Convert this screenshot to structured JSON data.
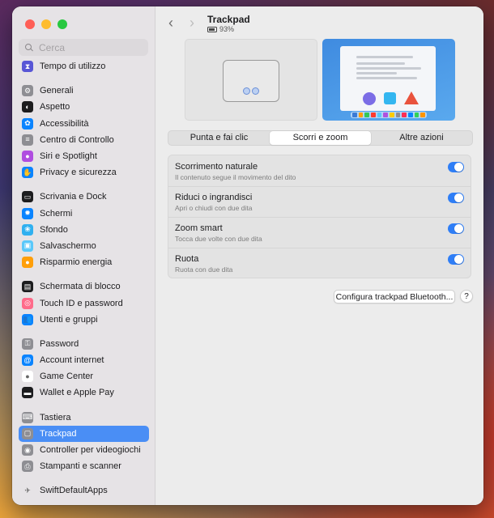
{
  "window": {
    "title": "Trackpad",
    "battery": "93%"
  },
  "search": {
    "placeholder": "Cerca"
  },
  "sidebar": {
    "items": [
      {
        "label": "Tempo di utilizzo",
        "icon": "hourglass-icon",
        "color": "#5856d6",
        "glyph": "⧗"
      },
      {
        "gap": true
      },
      {
        "label": "Generali",
        "icon": "gear-icon",
        "color": "#8e8e93",
        "glyph": "⚙"
      },
      {
        "label": "Aspetto",
        "icon": "appearance-icon",
        "color": "#1c1c1e",
        "glyph": "◐"
      },
      {
        "label": "Accessibilità",
        "icon": "accessibility-icon",
        "color": "#0a84ff",
        "glyph": "✿"
      },
      {
        "label": "Centro di Controllo",
        "icon": "control-center-icon",
        "color": "#8e8e93",
        "glyph": "≡"
      },
      {
        "label": "Siri e Spotlight",
        "icon": "siri-icon",
        "color": "#b04de0",
        "glyph": "●"
      },
      {
        "label": "Privacy e sicurezza",
        "icon": "hand-icon",
        "color": "#0a84ff",
        "glyph": "✋"
      },
      {
        "gap": true
      },
      {
        "label": "Scrivania e Dock",
        "icon": "dock-icon",
        "color": "#1c1c1e",
        "glyph": "▭"
      },
      {
        "label": "Schermi",
        "icon": "display-icon",
        "color": "#0a84ff",
        "glyph": "✹"
      },
      {
        "label": "Sfondo",
        "icon": "wallpaper-icon",
        "color": "#30b0f0",
        "glyph": "❀"
      },
      {
        "label": "Salvaschermo",
        "icon": "screensaver-icon",
        "color": "#5ac8fa",
        "glyph": "▣"
      },
      {
        "label": "Risparmio energia",
        "icon": "energy-icon",
        "color": "#ff9f0a",
        "glyph": "●"
      },
      {
        "gap": true
      },
      {
        "label": "Schermata di blocco",
        "icon": "lock-screen-icon",
        "color": "#1c1c1e",
        "glyph": "▤"
      },
      {
        "label": "Touch ID e password",
        "icon": "fingerprint-icon",
        "color": "#ff6b8a",
        "glyph": "◎"
      },
      {
        "label": "Utenti e gruppi",
        "icon": "users-icon",
        "color": "#0a84ff",
        "glyph": "👥"
      },
      {
        "gap": true
      },
      {
        "label": "Password",
        "icon": "key-icon",
        "color": "#8e8e93",
        "glyph": "⚿"
      },
      {
        "label": "Account internet",
        "icon": "at-icon",
        "color": "#0a84ff",
        "glyph": "@"
      },
      {
        "label": "Game Center",
        "icon": "game-center-icon",
        "color": "#ffffff",
        "glyph": "●"
      },
      {
        "label": "Wallet e Apple Pay",
        "icon": "wallet-icon",
        "color": "#1c1c1e",
        "glyph": "▬"
      },
      {
        "gap": true
      },
      {
        "label": "Tastiera",
        "icon": "keyboard-icon",
        "color": "#8e8e93",
        "glyph": "⌨"
      },
      {
        "label": "Trackpad",
        "icon": "trackpad-icon",
        "color": "#8e8e93",
        "glyph": "▢",
        "selected": true
      },
      {
        "label": "Controller per videogiochi",
        "icon": "gamepad-icon",
        "color": "#8e8e93",
        "glyph": "◉"
      },
      {
        "label": "Stampanti e scanner",
        "icon": "printer-icon",
        "color": "#8e8e93",
        "glyph": "⎙"
      },
      {
        "gap": true
      },
      {
        "label": "SwiftDefaultApps",
        "icon": "swift-icon",
        "color": "#e6e3e6",
        "glyph": "✈"
      }
    ]
  },
  "tabs": [
    {
      "label": "Punta e fai clic",
      "active": false
    },
    {
      "label": "Scorri e zoom",
      "active": true
    },
    {
      "label": "Altre azioni",
      "active": false
    }
  ],
  "settings": [
    {
      "title": "Scorrimento naturale",
      "subtitle": "Il contenuto segue il movimento del dito",
      "on": true
    },
    {
      "title": "Riduci o ingrandisci",
      "subtitle": "Apri o chiudi con due dita",
      "on": true
    },
    {
      "title": "Zoom smart",
      "subtitle": "Tocca due volte con due dita",
      "on": true
    },
    {
      "title": "Ruota",
      "subtitle": "Ruota con due dita",
      "on": true
    }
  ],
  "buttons": {
    "bluetooth": "Configura trackpad Bluetooth...",
    "help": "?"
  },
  "colors": {
    "accent": "#2f7ef6",
    "selection": "#4a8ef5"
  }
}
